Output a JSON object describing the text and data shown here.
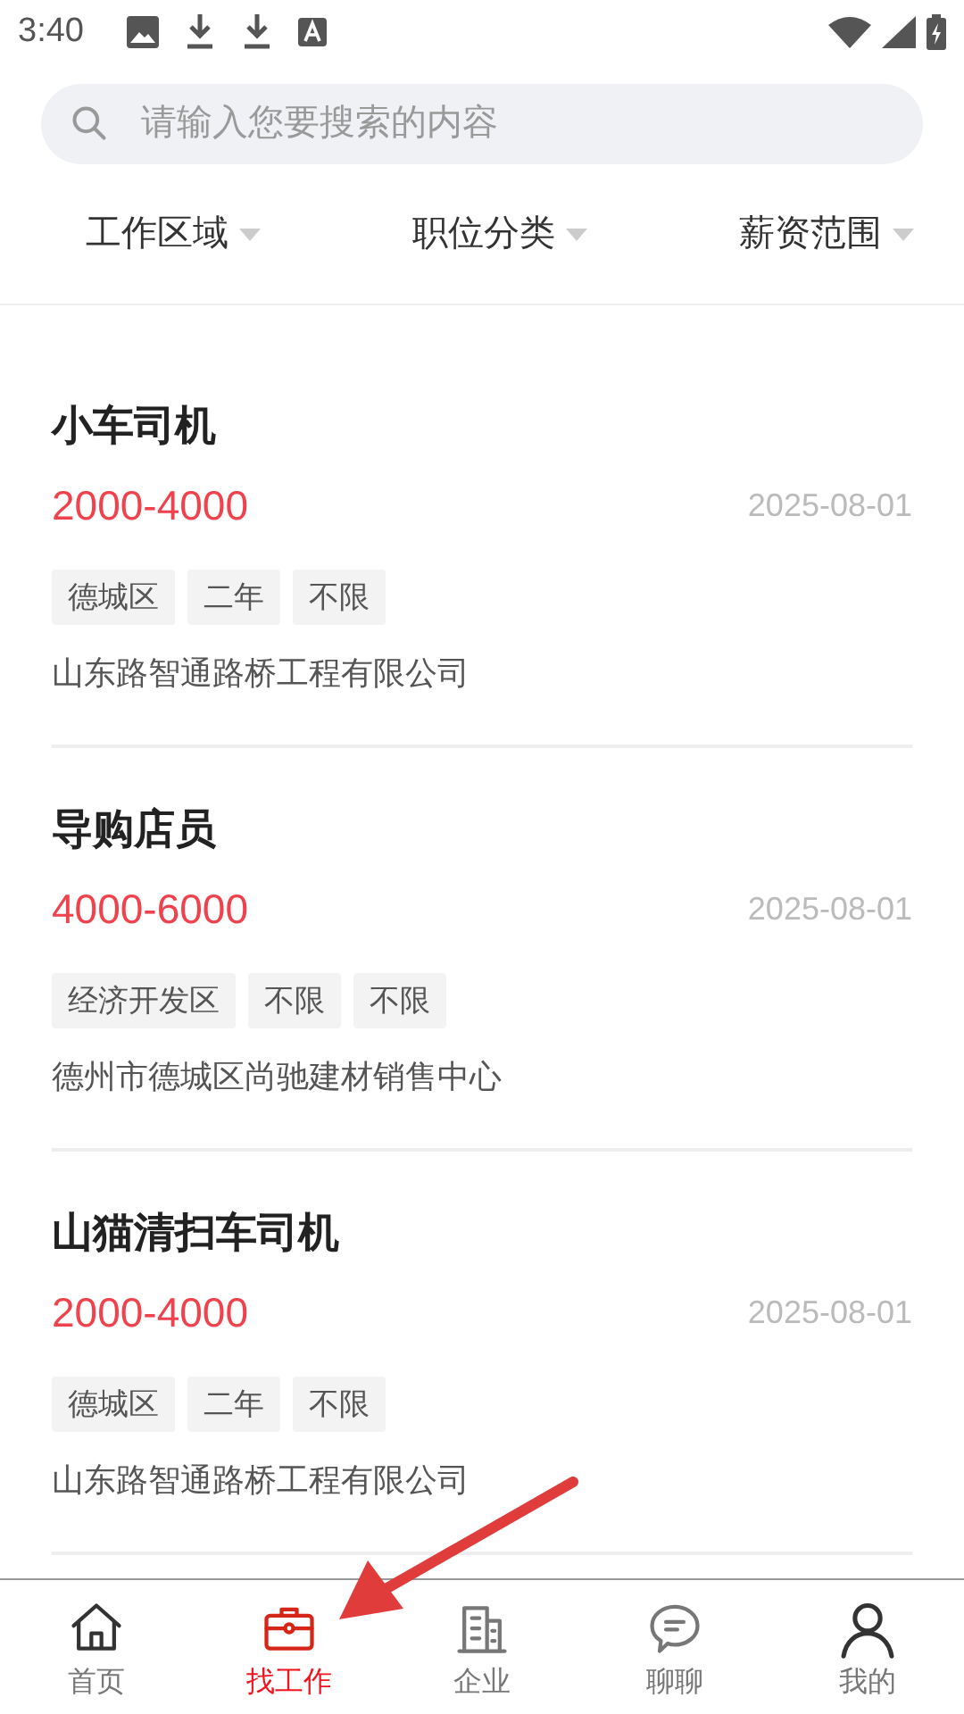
{
  "status_bar": {
    "time": "3:40"
  },
  "search": {
    "placeholder": "请输入您要搜索的内容"
  },
  "filters": [
    {
      "label": "工作区域"
    },
    {
      "label": "职位分类"
    },
    {
      "label": "薪资范围"
    }
  ],
  "jobs": [
    {
      "title": "小车司机",
      "salary": "2000-4000",
      "date": "2025-08-01",
      "tags": [
        "德城区",
        "二年",
        "不限"
      ],
      "company": "山东路智通路桥工程有限公司"
    },
    {
      "title": "导购店员",
      "salary": "4000-6000",
      "date": "2025-08-01",
      "tags": [
        "经济开发区",
        "不限",
        "不限"
      ],
      "company": "德州市德城区尚驰建材销售中心"
    },
    {
      "title": "山猫清扫车司机",
      "salary": "2000-4000",
      "date": "2025-08-01",
      "tags": [
        "德城区",
        "二年",
        "不限"
      ],
      "company": "山东路智通路桥工程有限公司"
    }
  ],
  "bottom_nav": [
    {
      "label": "首页",
      "kind": "home",
      "selected": false
    },
    {
      "label": "找工作",
      "kind": "jobs",
      "selected": true
    },
    {
      "label": "企业",
      "kind": "company",
      "selected": false
    },
    {
      "label": "聊聊",
      "kind": "chat",
      "selected": false
    },
    {
      "label": "我的",
      "kind": "me",
      "selected": false
    }
  ]
}
